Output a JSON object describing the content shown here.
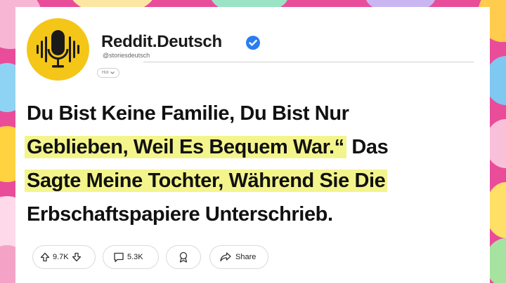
{
  "post": {
    "author": "Reddit.Deutsch",
    "handle": "@storiesdeutsch",
    "sort_pill": "Hot",
    "headline": {
      "line1": "Du Bist Keine Familie, Du Bist Nur",
      "line2_highlight": "Geblieben, Weil Es Bequem War.“",
      "line2_rest": " Das",
      "line3": "Sagte Meine Tochter, Während Sie Die",
      "line4": "Erbschaftspapiere Unterschrieb."
    }
  },
  "actions": {
    "upvotes": "9.7K",
    "comments": "5.3K",
    "share_label": "Share"
  },
  "colors": {
    "logo_bg": "#f4c617",
    "verified": "#2a7df0",
    "highlight": "#f3f58c",
    "background": "#e94d9a"
  },
  "icons": [
    "microphone-soundwave-icon",
    "verified-check-icon",
    "chevron-down-icon",
    "upvote-icon",
    "downvote-icon",
    "comment-icon",
    "award-icon",
    "share-icon"
  ]
}
